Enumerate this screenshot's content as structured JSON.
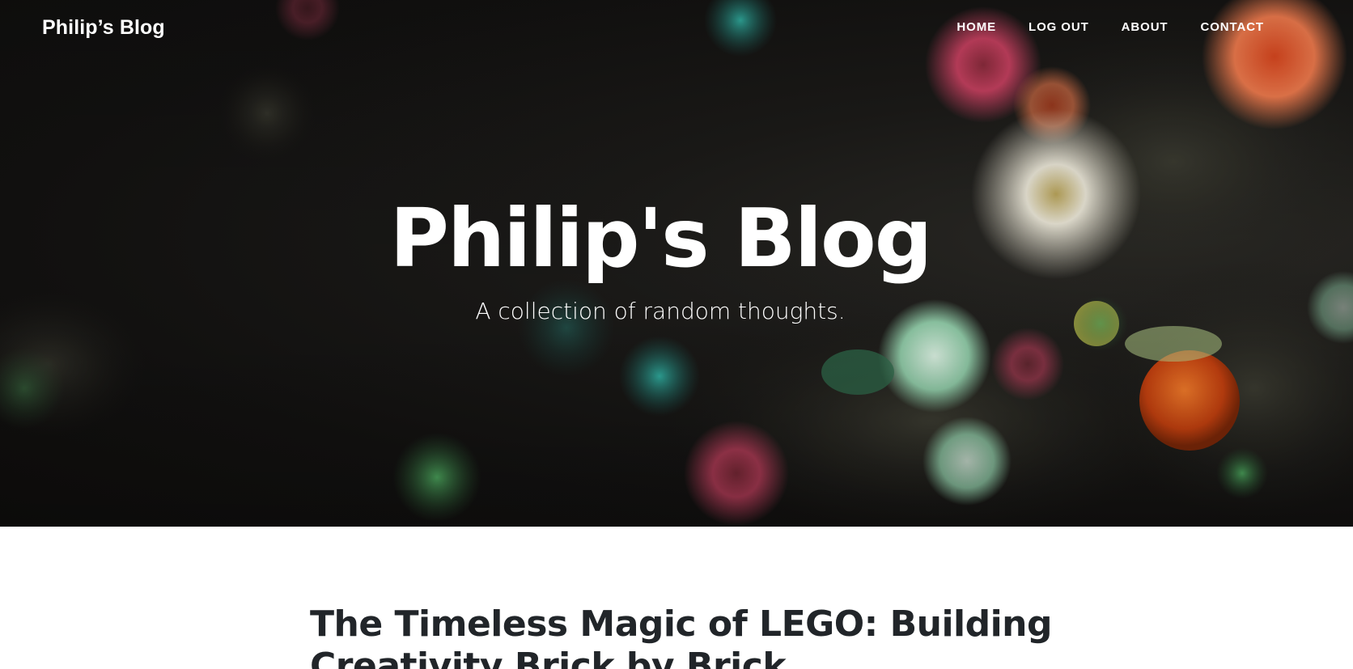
{
  "nav": {
    "brand": "Philip’s Blog",
    "items": [
      {
        "label": "HOME"
      },
      {
        "label": "LOG OUT"
      },
      {
        "label": "ABOUT"
      },
      {
        "label": "CONTACT"
      }
    ]
  },
  "hero": {
    "title": "Philip's Blog",
    "subtitle": "A collection of random thoughts."
  },
  "posts": [
    {
      "title": "The Timeless Magic of LEGO: Building Creativity Brick by Brick"
    }
  ],
  "colors": {
    "hero_background": "#141312",
    "text_light": "#ffffff",
    "text_dark": "#212529"
  }
}
